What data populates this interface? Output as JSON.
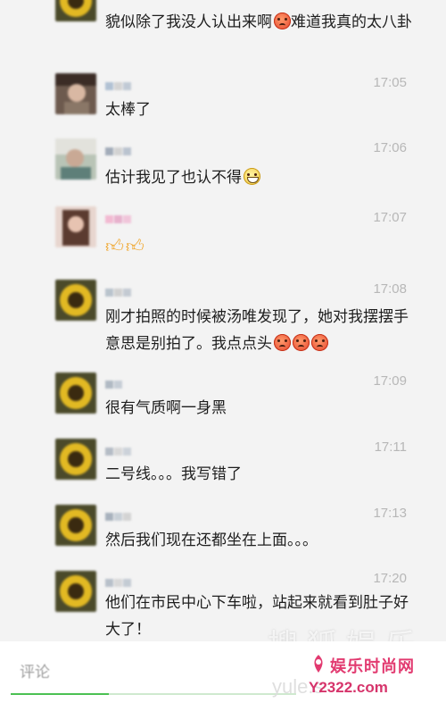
{
  "comments": [
    {
      "id": "c0",
      "name_masked": true,
      "time": "",
      "text": "貌似除了我没人认出来啊",
      "text_tail": "难道我真的太八卦",
      "emojis_mid": [
        "angry-face-icon"
      ],
      "avatar_style": "sunflower"
    },
    {
      "id": "c1",
      "name_masked": true,
      "time": "17:05",
      "text": "太棒了",
      "avatar_style": "portrait-dark"
    },
    {
      "id": "c2",
      "name_masked": true,
      "time": "17:06",
      "text": "估计我见了也认不得",
      "emojis": [
        "grinning-face-icon"
      ],
      "avatar_style": "portrait-light"
    },
    {
      "id": "c3",
      "name_masked": true,
      "time": "17:07",
      "text": "",
      "emojis": [
        "thumbs-up-icon",
        "thumbs-up-icon"
      ],
      "avatar_style": "portrait-pink"
    },
    {
      "id": "c4",
      "name_masked": true,
      "time": "17:08",
      "text": "刚才拍照的时候被汤唯发现了，她对我摆摆手意思是别拍了。我点点头",
      "emojis": [
        "angry-face-icon",
        "angry-face-icon",
        "angry-face-icon"
      ],
      "avatar_style": "sunflower"
    },
    {
      "id": "c5",
      "name_masked": true,
      "time": "17:09",
      "text": "很有气质啊一身黑",
      "avatar_style": "sunflower"
    },
    {
      "id": "c6",
      "name_masked": true,
      "time": "17:11",
      "text": "二号线。。。我写错了",
      "avatar_style": "sunflower"
    },
    {
      "id": "c7",
      "name_masked": true,
      "time": "17:13",
      "text": "然后我们现在还都坐在上面。。。",
      "avatar_style": "sunflower"
    },
    {
      "id": "c8",
      "name_masked": true,
      "time": "17:20",
      "text": "他们在市民中心下车啦，站起来就看到肚子好大了！",
      "avatar_style": "sunflower"
    }
  ],
  "input": {
    "placeholder": "评论"
  },
  "watermark": {
    "cn": "搜狐娱乐",
    "en": "yule.s"
  },
  "brand": {
    "name": "娱乐时尚网",
    "url": "Y2322.com"
  },
  "colors": {
    "feed_bg": "#f3f3f3",
    "time": "#b7b7b7",
    "text": "#1e1e1e",
    "input_accent": "#4cc153",
    "brand": "#e23a70"
  }
}
